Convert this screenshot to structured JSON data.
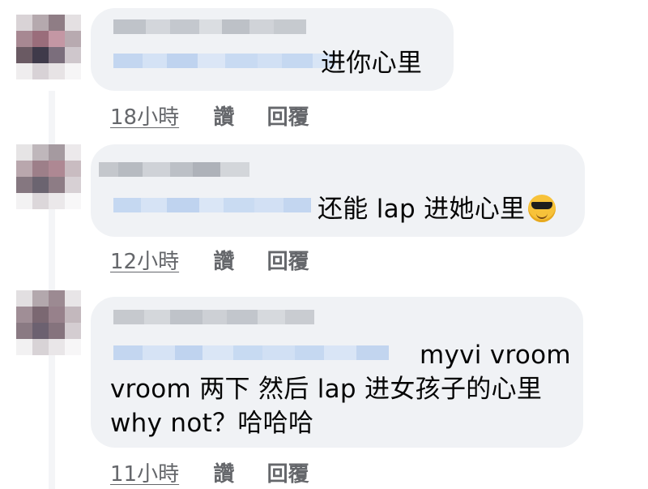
{
  "comments": [
    {
      "text_lines": [
        "进你心里"
      ],
      "has_emoji": false,
      "time": "18小時",
      "like_label": "讚",
      "reply_label": "回覆"
    },
    {
      "text_lines": [
        "还能 lap 进她心里"
      ],
      "has_emoji": true,
      "emoji_icon": "sunglasses-face-icon",
      "time": "12小時",
      "like_label": "讚",
      "reply_label": "回覆"
    },
    {
      "text_lines": [
        "myvi vroom",
        "vroom 两下 然后 lap 进女孩子的心里",
        "why not？哈哈哈"
      ],
      "has_emoji": false,
      "time": "11小時",
      "like_label": "讚",
      "reply_label": "回覆"
    }
  ],
  "colors": {
    "bubble": "#f0f2f5",
    "meta_text": "#65676b",
    "body_text": "#050505",
    "redacted_name": "#c9ccd1",
    "redacted_mention": "#c7daf4"
  }
}
